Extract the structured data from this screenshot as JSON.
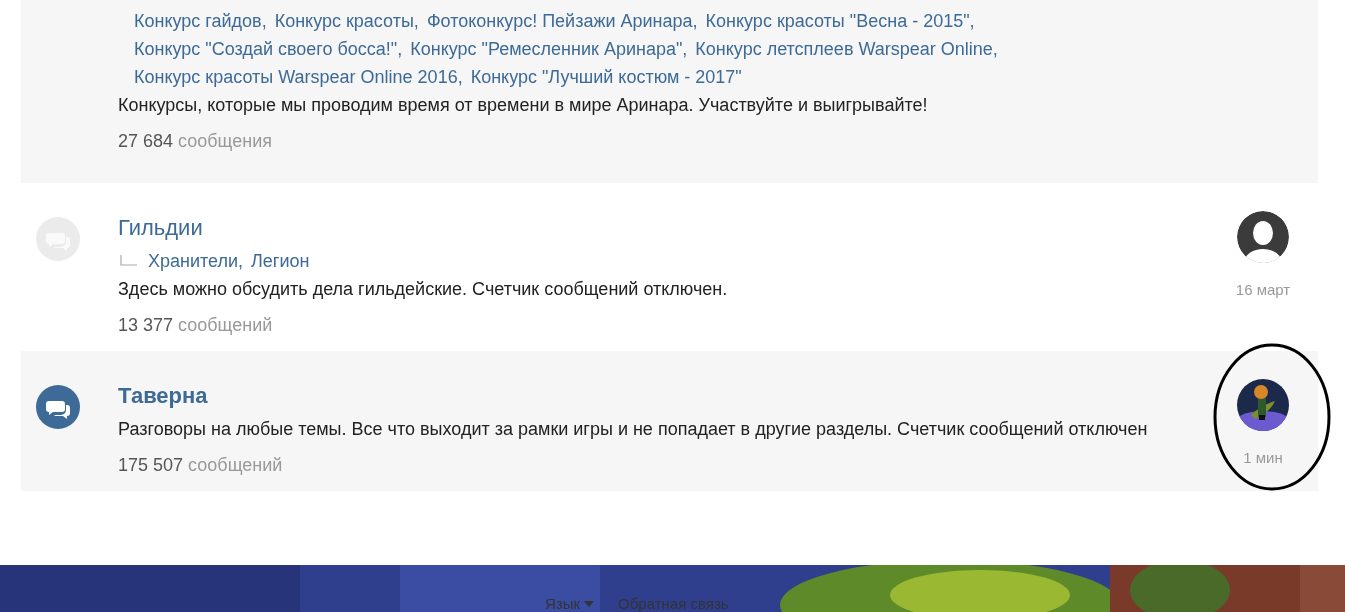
{
  "forums": [
    {
      "subforums": [
        "Конкурс гайдов,",
        "Конкурс красоты,",
        "Фотоконкурс! Пейзажи Аринара,",
        "Конкурс красоты \"Весна - 2015\",",
        "Конкурс \"Создай своего босса!\",",
        "Конкурс \"Ремесленник Аринара\",",
        "Конкурс летсплеев Warspear Online,",
        "Конкурс красоты Warspear Online 2016,",
        "Конкурс \"Лучший костюм - 2017\""
      ],
      "description": "Конкурсы, которые мы проводим время от времени в мире Аринара. Участвуйте и выигрывайте!",
      "count": "27 684",
      "count_label": "сообщения"
    },
    {
      "title": "Гильдии",
      "unread": false,
      "subforums": [
        "Хранители,",
        "Легион"
      ],
      "description": "Здесь можно обсудить дела гильдейские. Счетчик сообщений отключен.",
      "count": "13 377",
      "count_label": "сообщений",
      "last_post": {
        "kind": "silhouette",
        "time": "16 март"
      }
    },
    {
      "title": "Таверна",
      "unread": true,
      "description": "Разговоры на любые темы. Все что выходит за рамки игры и не попадает в другие разделы. Счетчик сообщений отключен",
      "count": "175 507",
      "count_label": "сообщений",
      "last_post": {
        "kind": "picture",
        "time": "1 мин"
      }
    }
  ],
  "footer": {
    "links": [
      {
        "label": "Язык",
        "dropdown": true
      },
      {
        "label": "Обратная связь",
        "dropdown": false
      }
    ]
  }
}
